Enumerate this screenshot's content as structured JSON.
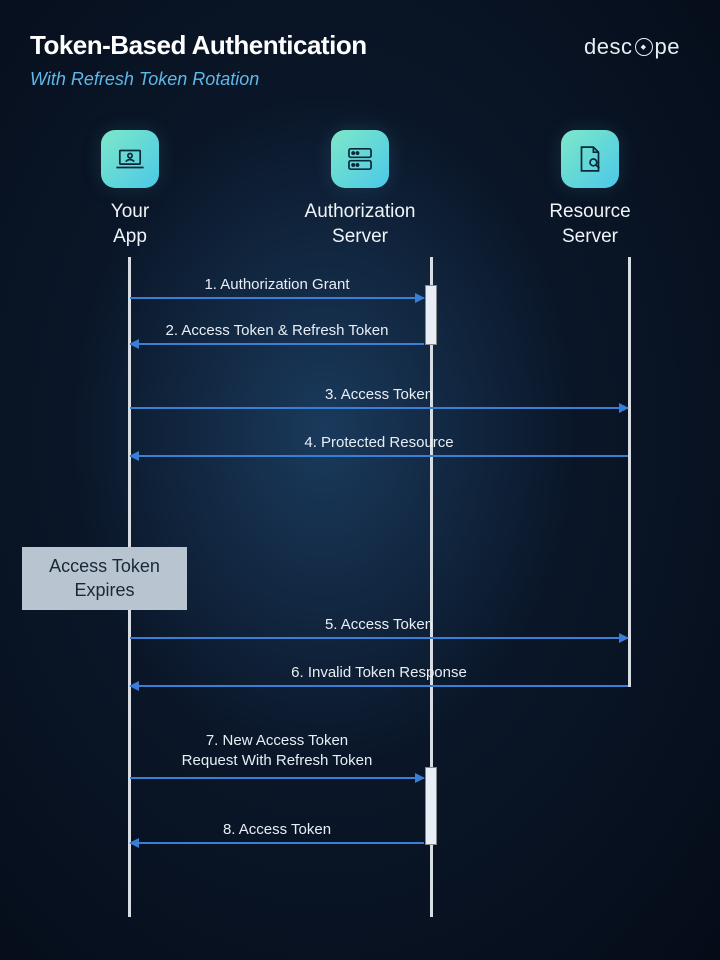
{
  "header": {
    "title": "Token-Based Authentication",
    "subtitle": "With Refresh Token Rotation",
    "brand_pre": "desc",
    "brand_post": "pe"
  },
  "actors": {
    "app": "Your\nApp",
    "auth": "Authorization\nServer",
    "resource": "Resource\nServer"
  },
  "steps": {
    "s1": "1. Authorization Grant",
    "s2": "2. Access Token & Refresh Token",
    "s3": "3. Access Token",
    "s4": "4. Protected Resource",
    "s5": "5. Access Token",
    "s6": "6. Invalid Token Response",
    "s7": "7. New Access Token\nRequest With Refresh Token",
    "s8": "8. Access Token"
  },
  "expire_label": "Access Token Expires"
}
